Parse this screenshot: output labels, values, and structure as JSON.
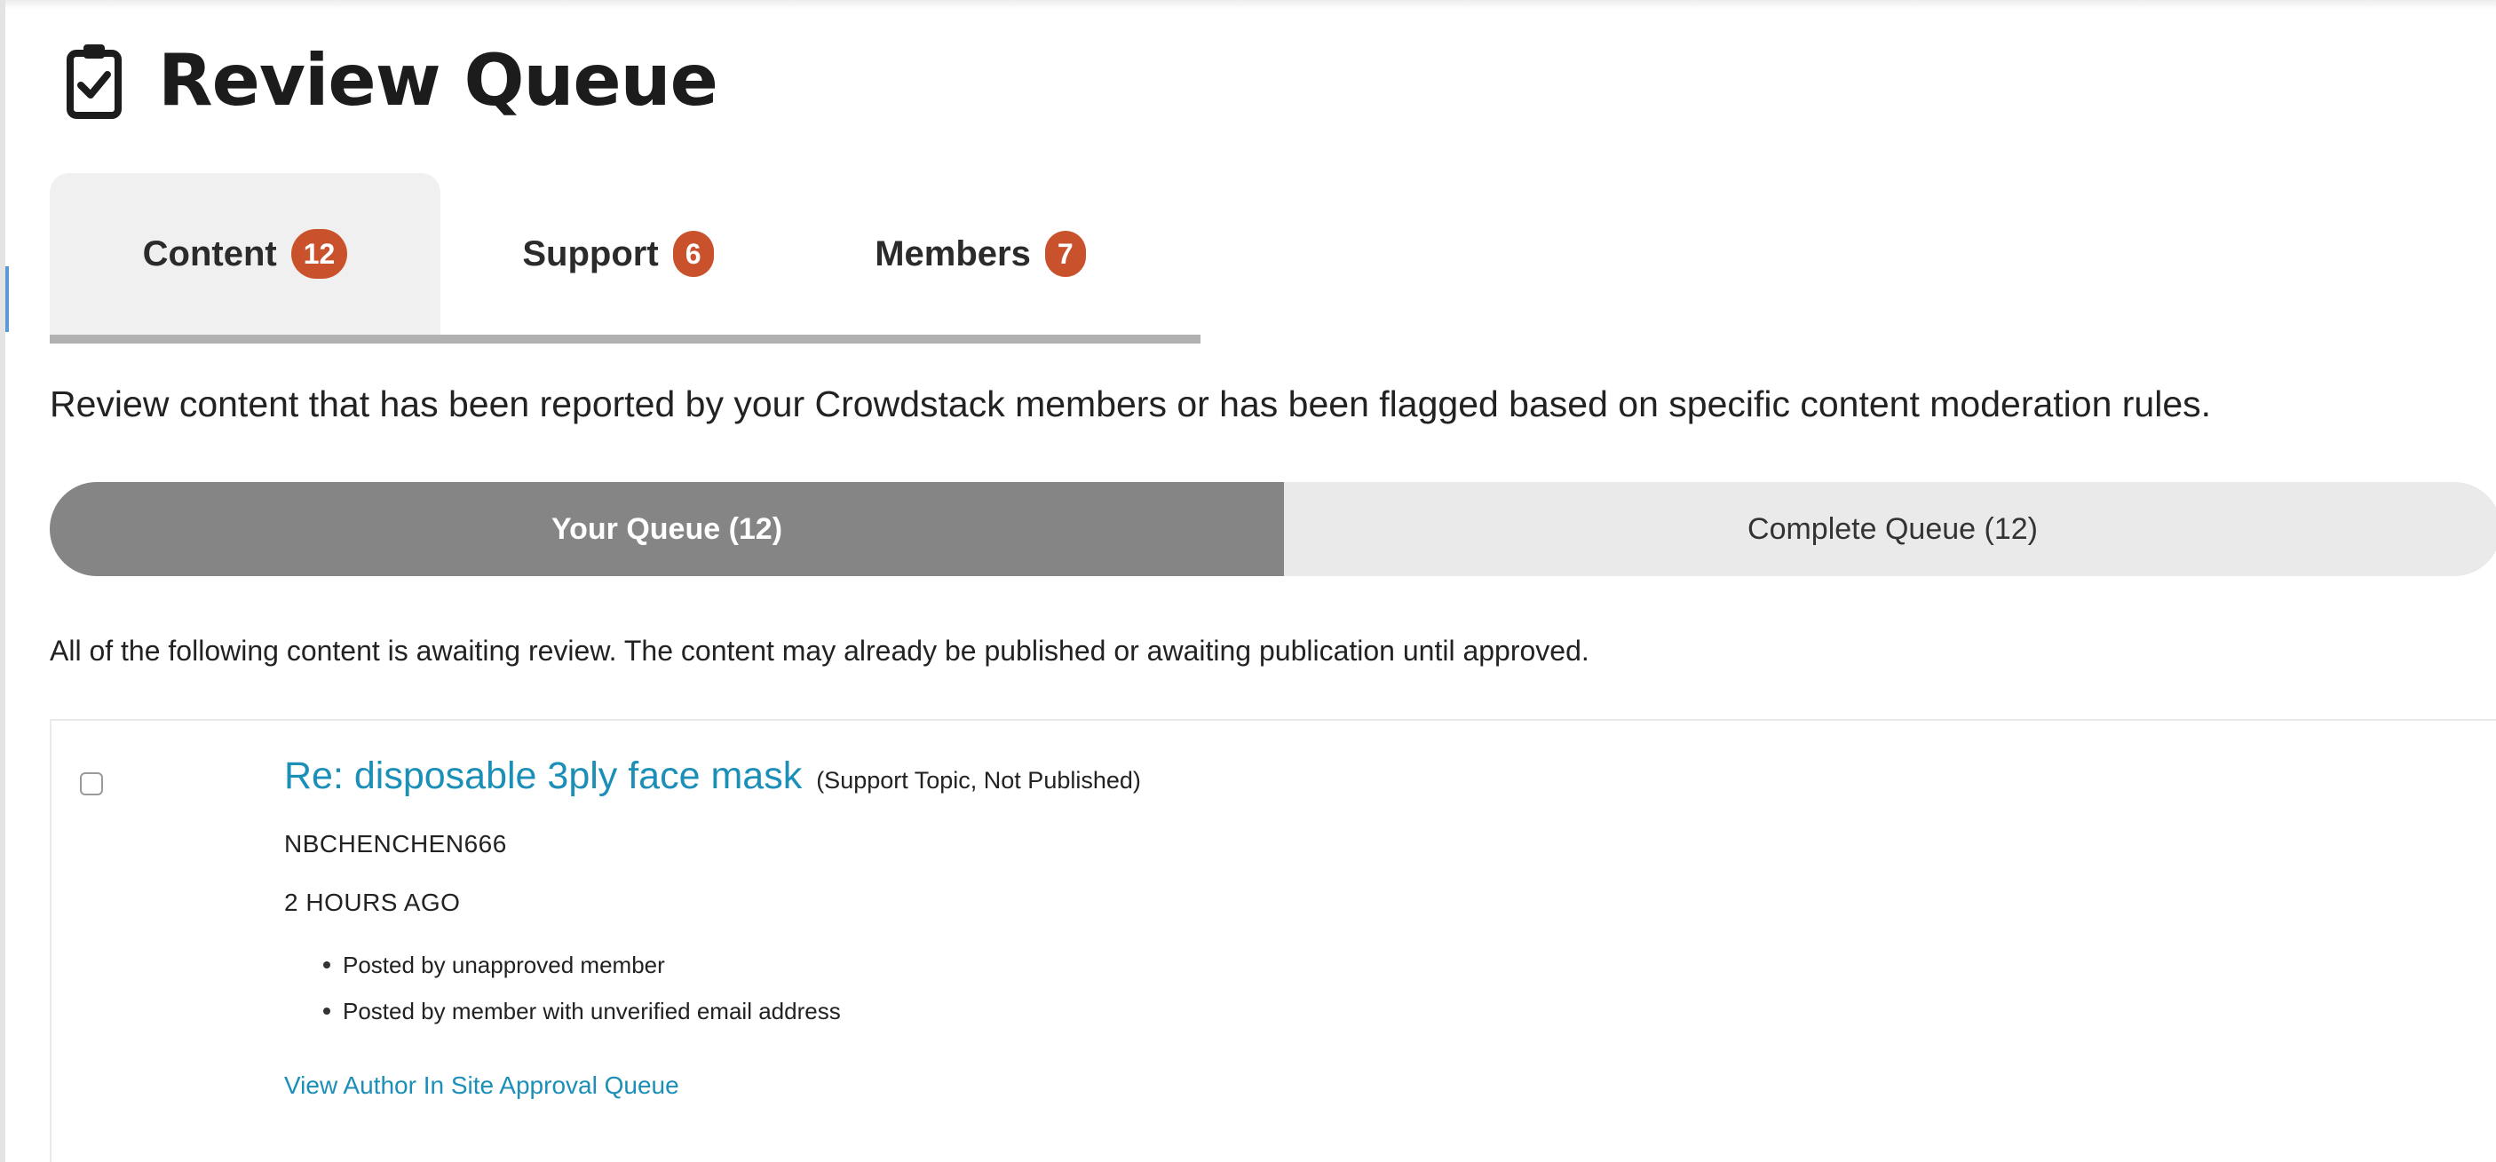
{
  "header": {
    "title": "Review Queue",
    "icon": "clipboard-check-icon"
  },
  "tabs": [
    {
      "label": "Content",
      "count": "12",
      "active": true
    },
    {
      "label": "Support",
      "count": "6",
      "active": false
    },
    {
      "label": "Members",
      "count": "7",
      "active": false
    }
  ],
  "description": "Review content that has been reported by your Crowdstack members or has been flagged based on specific content moderation rules.",
  "queue_toggle": {
    "your_queue": "Your Queue (12)",
    "complete_queue": "Complete Queue (12)"
  },
  "note": "All of the following content is awaiting review. The content may already be published or awaiting publication until approved.",
  "items": [
    {
      "title": "Re: disposable 3ply face mask",
      "meta": "(Support Topic, Not Published)",
      "author": "NBCHENCHEN666",
      "time": "2 HOURS AGO",
      "reasons": [
        "Posted by unapproved member",
        "Posted by member with unverified email address"
      ],
      "link": "View Author In Site Approval Queue",
      "checked": false
    }
  ],
  "colors": {
    "badge": "#c9522c",
    "active_tab_underline": "#5bb5e8",
    "link": "#1b8fb7",
    "selected_queue": "#858585",
    "unselected_queue": "#eaeaea"
  }
}
